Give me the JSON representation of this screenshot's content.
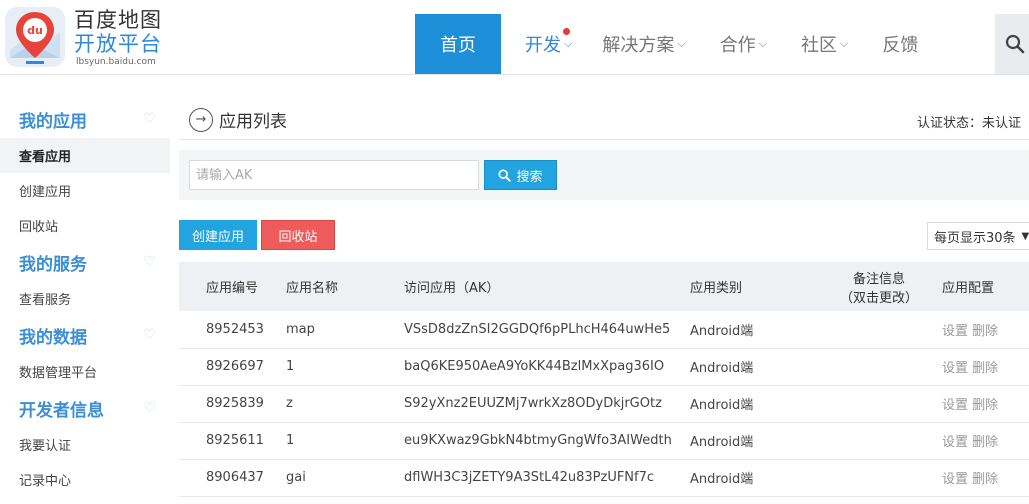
{
  "brand": {
    "line1": "百度地图",
    "line2": "开放平台",
    "domain": "lbsyun.baidu.com",
    "badge": "du"
  },
  "nav": [
    {
      "label": "首页",
      "active": true
    },
    {
      "label": "开发",
      "chevron": true,
      "dot": true
    },
    {
      "label": "解决方案",
      "chevron": true
    },
    {
      "label": "合作",
      "chevron": true
    },
    {
      "label": "社区",
      "chevron": true
    },
    {
      "label": "反馈"
    }
  ],
  "sidebar": {
    "groups": [
      {
        "title": "我的应用",
        "items": [
          "查看应用",
          "创建应用",
          "回收站"
        ]
      },
      {
        "title": "我的服务",
        "items": [
          "查看服务"
        ]
      },
      {
        "title": "我的数据",
        "items": [
          "数据管理平台"
        ]
      },
      {
        "title": "开发者信息",
        "items": [
          "我要认证",
          "记录中心"
        ]
      }
    ]
  },
  "main": {
    "title": "应用列表",
    "cert_status": "认证状态：未认证",
    "search": {
      "placeholder": "请输入AK",
      "button": "搜索"
    },
    "create_button": "创建应用",
    "recycle_button": "回收站",
    "page_size": "每页显示30条",
    "table": {
      "headers": [
        "应用编号",
        "应用名称",
        "访问应用（AK）",
        "应用类别",
        "备注信息",
        "（双击更改）",
        "应用配置"
      ],
      "action_set": "设置",
      "action_del": "删除",
      "rows": [
        {
          "id": "8952453",
          "name": "map",
          "ak": "VSsD8dzZnSI2GGDQf6pPLhcH464uwHe5",
          "type": "Android端",
          "note": ""
        },
        {
          "id": "8926697",
          "name": "1",
          "ak": "baQ6KE950AeA9YoKK44BzlMxXpag36IO",
          "type": "Android端",
          "note": ""
        },
        {
          "id": "8925839",
          "name": "z",
          "ak": "S92yXnz2EUUZMj7wrkXz8ODyDkjrGOtz",
          "type": "Android端",
          "note": ""
        },
        {
          "id": "8925611",
          "name": "1",
          "ak": "eu9KXwaz9GbkN4btmyGngWfo3AIWedth",
          "type": "Android端",
          "note": ""
        },
        {
          "id": "8906437",
          "name": "gai",
          "ak": "dflWH3C3jZETY9A3StL42u83PzUFNf7c",
          "type": "Android端",
          "note": ""
        }
      ]
    }
  },
  "colors": {
    "accent": "#1d8ed8",
    "brand_blue": "#2f89d8",
    "danger": "#ee5b5b",
    "button": "#21a4df"
  }
}
